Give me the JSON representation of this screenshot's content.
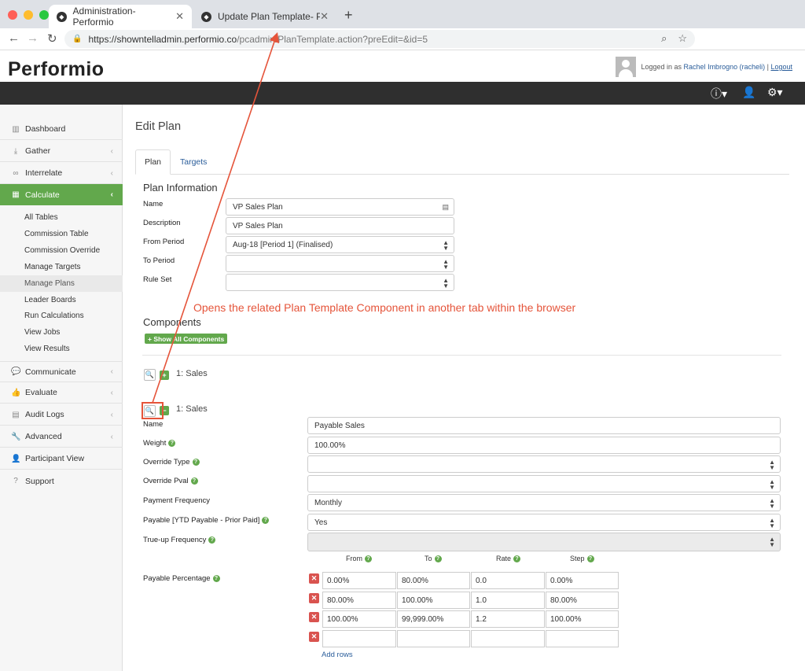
{
  "browser": {
    "tabs": [
      {
        "title": "Administration- Performio",
        "active": true
      },
      {
        "title": "Update Plan Template- Perform",
        "active": false
      }
    ],
    "url_host": "https://showntelladmin.performio.co",
    "url_path": "/pcadmin/PlanTemplate.action?preEdit=&id=5"
  },
  "header": {
    "logo": "Performio",
    "logged_in_prefix": "Logged in as",
    "user_name": "Rachel Imbrogno (racheli)",
    "separator": "|",
    "logout": "Logout"
  },
  "sidebar": {
    "items": [
      {
        "label": "Dashboard",
        "icon": "chart-icon"
      },
      {
        "label": "Gather",
        "icon": "download-icon"
      },
      {
        "label": "Interrelate",
        "icon": "link-icon"
      },
      {
        "label": "Calculate",
        "icon": "table-icon"
      },
      {
        "label": "Communicate",
        "icon": "comments-icon"
      },
      {
        "label": "Evaluate",
        "icon": "thumbs-up-icon"
      },
      {
        "label": "Audit Logs",
        "icon": "document-icon"
      },
      {
        "label": "Advanced",
        "icon": "wrench-icon"
      },
      {
        "label": "Participant View",
        "icon": "user-icon"
      },
      {
        "label": "Support",
        "icon": "help-icon"
      }
    ],
    "calculate_sub": [
      "All Tables",
      "Commission Table",
      "Commission Override",
      "Manage Targets",
      "Manage Plans",
      "Leader Boards",
      "Run Calculations",
      "View Jobs",
      "View Results"
    ]
  },
  "main": {
    "title": "Edit Plan",
    "tabs": [
      "Plan",
      "Targets"
    ],
    "plan_info_heading": "Plan Information",
    "fields": {
      "name_label": "Name",
      "name_value": "VP Sales Plan",
      "description_label": "Description",
      "description_value": "VP Sales Plan",
      "from_period_label": "From Period",
      "from_period_value": "Aug-18 [Period 1] (Finalised)",
      "to_period_label": "To Period",
      "to_period_value": "",
      "rule_set_label": "Rule Set",
      "rule_set_value": ""
    },
    "annotation": "Opens the related Plan Template Component in another tab within the browser",
    "components_heading": "Components",
    "show_all_button": "+ Show All Components",
    "components": [
      "1: Sales",
      "1: Sales"
    ],
    "component_form": {
      "name_label": "Name",
      "name_value": "Payable Sales",
      "weight_label": "Weight",
      "weight_value": "100.00%",
      "override_type_label": "Override Type",
      "override_type_value": "",
      "override_pval_label": "Override Pval",
      "override_pval_value": "",
      "payment_frequency_label": "Payment Frequency",
      "payment_frequency_value": "Monthly",
      "payable_label": "Payable [YTD Payable - Prior Paid]",
      "payable_value": "Yes",
      "trueup_label": "True-up Frequency",
      "trueup_value": "",
      "payable_pct_label": "Payable Percentage"
    },
    "rate_table": {
      "headers": [
        "From",
        "To",
        "Rate",
        "Step"
      ],
      "rows": [
        [
          "0.00%",
          "80.00%",
          "0.0",
          "0.00%"
        ],
        [
          "80.00%",
          "100.00%",
          "1.0",
          "80.00%"
        ],
        [
          "100.00%",
          "99,999.00%",
          "1.2",
          "100.00%"
        ],
        [
          "",
          "",
          "",
          ""
        ]
      ],
      "add_rows": "Add rows"
    }
  },
  "colors": {
    "accent_green": "#62a84c",
    "annotation_red": "#e5543a",
    "top_nav": "#2f2f2f",
    "link_blue": "#2a5d9a"
  }
}
